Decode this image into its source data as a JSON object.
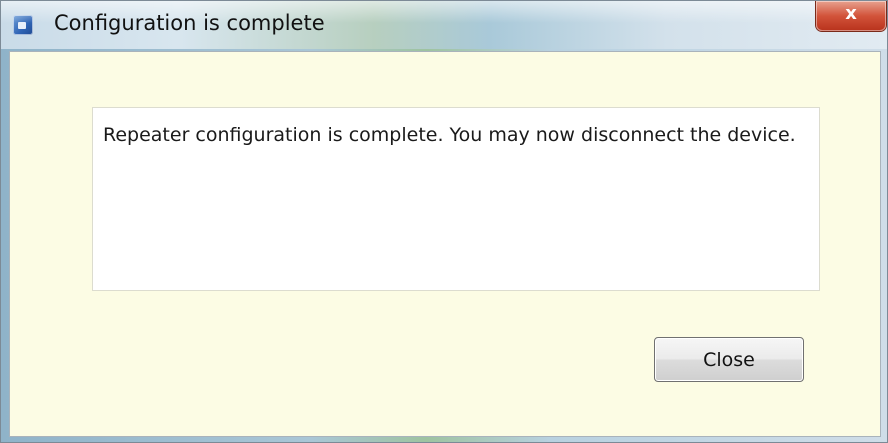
{
  "window": {
    "title": "Configuration is complete",
    "close_glyph": "x"
  },
  "dialog": {
    "message": "Repeater configuration is complete. You may now disconnect the device.",
    "close_button_label": "Close"
  },
  "icons": {
    "app": "app-window-icon",
    "close": "close-icon"
  },
  "colors": {
    "client_background": "#fcfce4",
    "close_accent": "#d2533a"
  }
}
